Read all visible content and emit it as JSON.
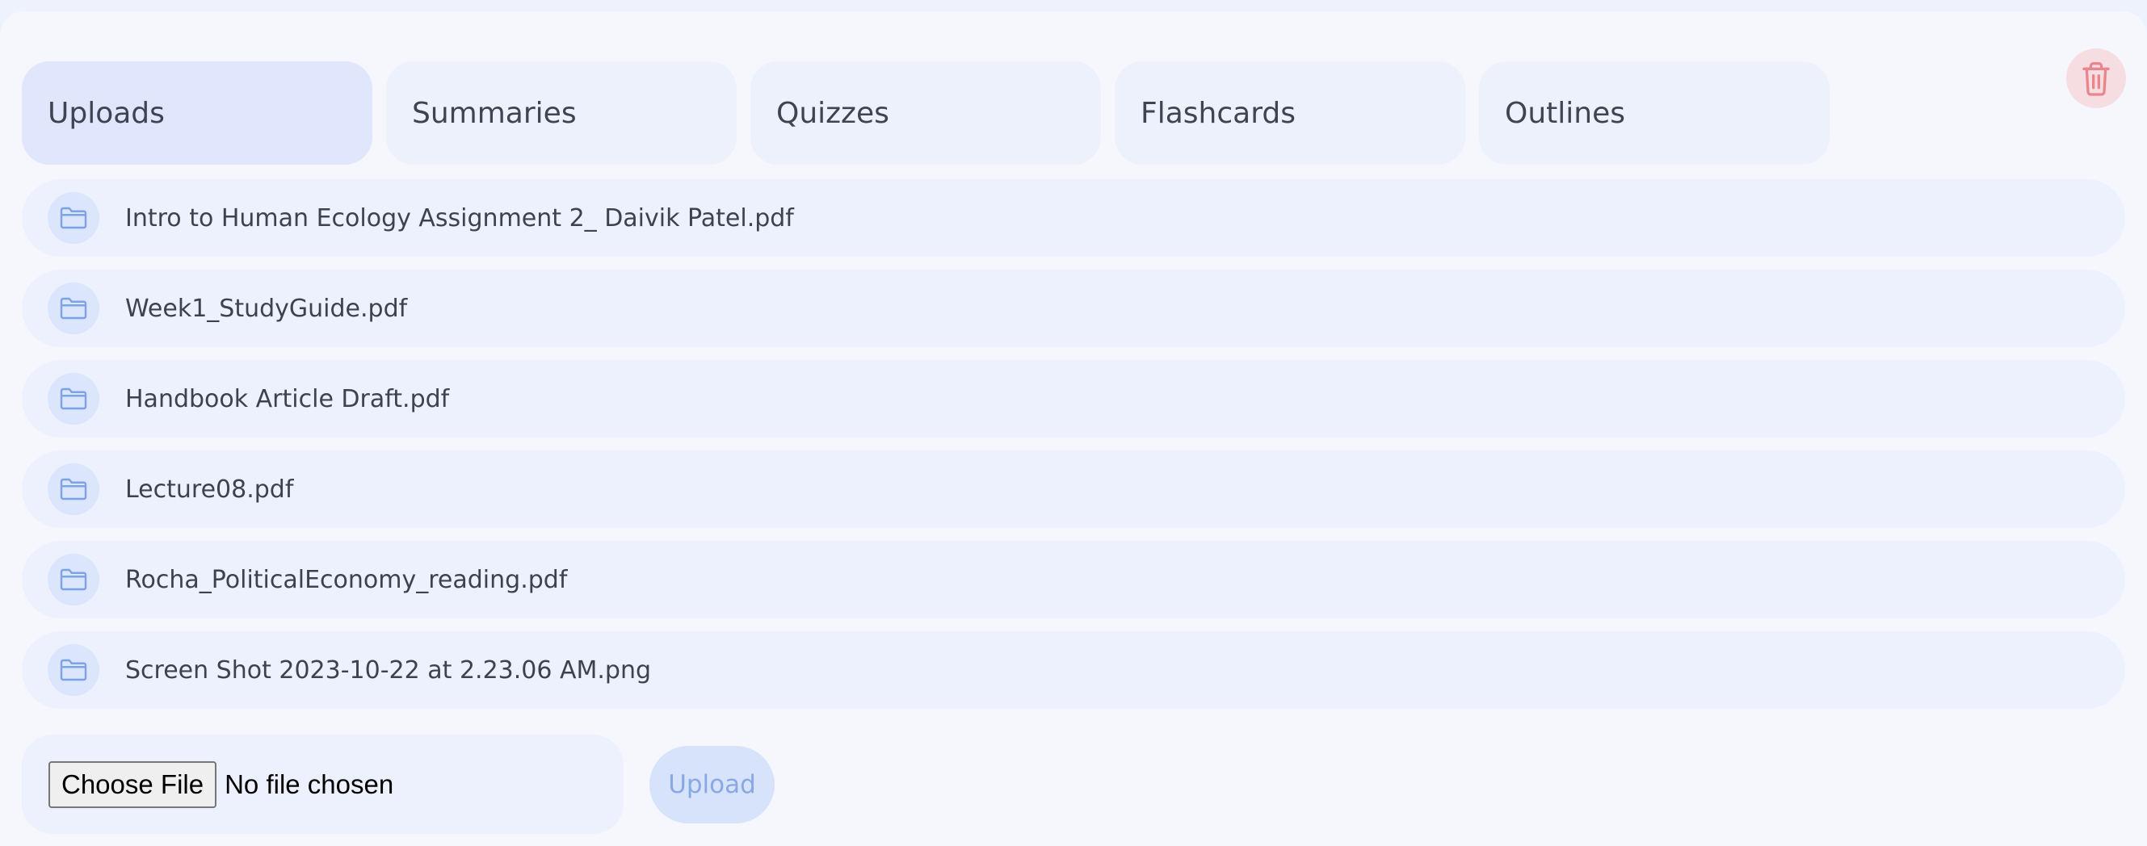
{
  "tabs": [
    {
      "label": "Uploads",
      "active": true
    },
    {
      "label": "Summaries",
      "active": false
    },
    {
      "label": "Quizzes",
      "active": false
    },
    {
      "label": "Flashcards",
      "active": false
    },
    {
      "label": "Outlines",
      "active": false
    }
  ],
  "files": [
    {
      "name": "Intro to Human Ecology Assignment 2_ Daivik Patel.pdf",
      "icon": "folder-icon"
    },
    {
      "name": "Week1_StudyGuide.pdf",
      "icon": "folder-icon"
    },
    {
      "name": "Handbook Article Draft.pdf",
      "icon": "folder-icon"
    },
    {
      "name": "Lecture08.pdf",
      "icon": "folder-icon"
    },
    {
      "name": "Rocha_PoliticalEconomy_reading.pdf",
      "icon": "folder-icon"
    },
    {
      "name": "Screen Shot 2023-10-22 at 2.23.06 AM.png",
      "icon": "folder-icon"
    }
  ],
  "file_input": {
    "choose_label": "Choose File",
    "status": "No file chosen"
  },
  "upload_button": {
    "label": "Upload"
  },
  "delete": {
    "icon": "trash-icon"
  },
  "colors": {
    "accent": "#e0e6fb",
    "row_bg": "#edf1fd",
    "icon_color": "#7ba3e6",
    "delete_icon": "#e9868d",
    "delete_bg": "#f6dde1",
    "upload_text": "#89a8e4"
  }
}
